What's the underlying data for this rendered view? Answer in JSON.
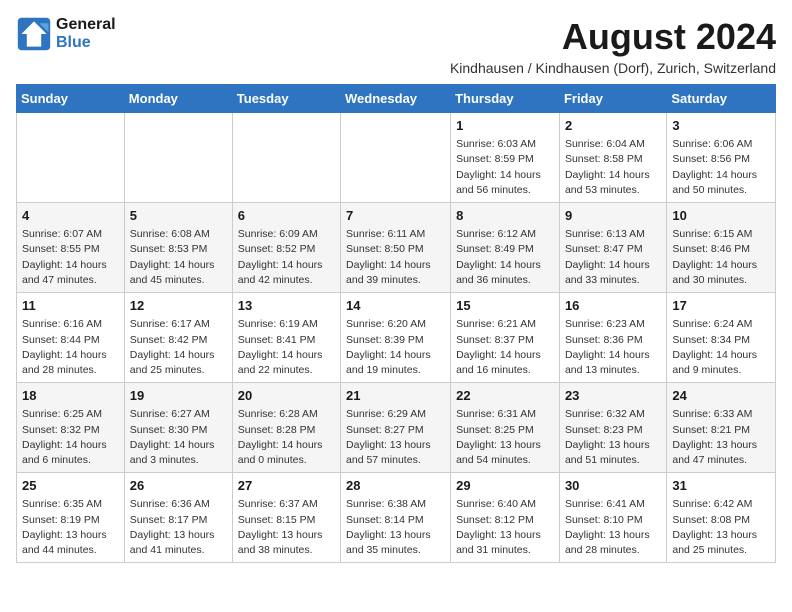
{
  "logo": {
    "line1": "General",
    "line2": "Blue"
  },
  "title": "August 2024",
  "subtitle": "Kindhausen / Kindhausen (Dorf), Zurich, Switzerland",
  "days_of_week": [
    "Sunday",
    "Monday",
    "Tuesday",
    "Wednesday",
    "Thursday",
    "Friday",
    "Saturday"
  ],
  "weeks": [
    [
      {
        "day": "",
        "info": ""
      },
      {
        "day": "",
        "info": ""
      },
      {
        "day": "",
        "info": ""
      },
      {
        "day": "",
        "info": ""
      },
      {
        "day": "1",
        "info": "Sunrise: 6:03 AM\nSunset: 8:59 PM\nDaylight: 14 hours and 56 minutes."
      },
      {
        "day": "2",
        "info": "Sunrise: 6:04 AM\nSunset: 8:58 PM\nDaylight: 14 hours and 53 minutes."
      },
      {
        "day": "3",
        "info": "Sunrise: 6:06 AM\nSunset: 8:56 PM\nDaylight: 14 hours and 50 minutes."
      }
    ],
    [
      {
        "day": "4",
        "info": "Sunrise: 6:07 AM\nSunset: 8:55 PM\nDaylight: 14 hours and 47 minutes."
      },
      {
        "day": "5",
        "info": "Sunrise: 6:08 AM\nSunset: 8:53 PM\nDaylight: 14 hours and 45 minutes."
      },
      {
        "day": "6",
        "info": "Sunrise: 6:09 AM\nSunset: 8:52 PM\nDaylight: 14 hours and 42 minutes."
      },
      {
        "day": "7",
        "info": "Sunrise: 6:11 AM\nSunset: 8:50 PM\nDaylight: 14 hours and 39 minutes."
      },
      {
        "day": "8",
        "info": "Sunrise: 6:12 AM\nSunset: 8:49 PM\nDaylight: 14 hours and 36 minutes."
      },
      {
        "day": "9",
        "info": "Sunrise: 6:13 AM\nSunset: 8:47 PM\nDaylight: 14 hours and 33 minutes."
      },
      {
        "day": "10",
        "info": "Sunrise: 6:15 AM\nSunset: 8:46 PM\nDaylight: 14 hours and 30 minutes."
      }
    ],
    [
      {
        "day": "11",
        "info": "Sunrise: 6:16 AM\nSunset: 8:44 PM\nDaylight: 14 hours and 28 minutes."
      },
      {
        "day": "12",
        "info": "Sunrise: 6:17 AM\nSunset: 8:42 PM\nDaylight: 14 hours and 25 minutes."
      },
      {
        "day": "13",
        "info": "Sunrise: 6:19 AM\nSunset: 8:41 PM\nDaylight: 14 hours and 22 minutes."
      },
      {
        "day": "14",
        "info": "Sunrise: 6:20 AM\nSunset: 8:39 PM\nDaylight: 14 hours and 19 minutes."
      },
      {
        "day": "15",
        "info": "Sunrise: 6:21 AM\nSunset: 8:37 PM\nDaylight: 14 hours and 16 minutes."
      },
      {
        "day": "16",
        "info": "Sunrise: 6:23 AM\nSunset: 8:36 PM\nDaylight: 14 hours and 13 minutes."
      },
      {
        "day": "17",
        "info": "Sunrise: 6:24 AM\nSunset: 8:34 PM\nDaylight: 14 hours and 9 minutes."
      }
    ],
    [
      {
        "day": "18",
        "info": "Sunrise: 6:25 AM\nSunset: 8:32 PM\nDaylight: 14 hours and 6 minutes."
      },
      {
        "day": "19",
        "info": "Sunrise: 6:27 AM\nSunset: 8:30 PM\nDaylight: 14 hours and 3 minutes."
      },
      {
        "day": "20",
        "info": "Sunrise: 6:28 AM\nSunset: 8:28 PM\nDaylight: 14 hours and 0 minutes."
      },
      {
        "day": "21",
        "info": "Sunrise: 6:29 AM\nSunset: 8:27 PM\nDaylight: 13 hours and 57 minutes."
      },
      {
        "day": "22",
        "info": "Sunrise: 6:31 AM\nSunset: 8:25 PM\nDaylight: 13 hours and 54 minutes."
      },
      {
        "day": "23",
        "info": "Sunrise: 6:32 AM\nSunset: 8:23 PM\nDaylight: 13 hours and 51 minutes."
      },
      {
        "day": "24",
        "info": "Sunrise: 6:33 AM\nSunset: 8:21 PM\nDaylight: 13 hours and 47 minutes."
      }
    ],
    [
      {
        "day": "25",
        "info": "Sunrise: 6:35 AM\nSunset: 8:19 PM\nDaylight: 13 hours and 44 minutes."
      },
      {
        "day": "26",
        "info": "Sunrise: 6:36 AM\nSunset: 8:17 PM\nDaylight: 13 hours and 41 minutes."
      },
      {
        "day": "27",
        "info": "Sunrise: 6:37 AM\nSunset: 8:15 PM\nDaylight: 13 hours and 38 minutes."
      },
      {
        "day": "28",
        "info": "Sunrise: 6:38 AM\nSunset: 8:14 PM\nDaylight: 13 hours and 35 minutes."
      },
      {
        "day": "29",
        "info": "Sunrise: 6:40 AM\nSunset: 8:12 PM\nDaylight: 13 hours and 31 minutes."
      },
      {
        "day": "30",
        "info": "Sunrise: 6:41 AM\nSunset: 8:10 PM\nDaylight: 13 hours and 28 minutes."
      },
      {
        "day": "31",
        "info": "Sunrise: 6:42 AM\nSunset: 8:08 PM\nDaylight: 13 hours and 25 minutes."
      }
    ]
  ]
}
